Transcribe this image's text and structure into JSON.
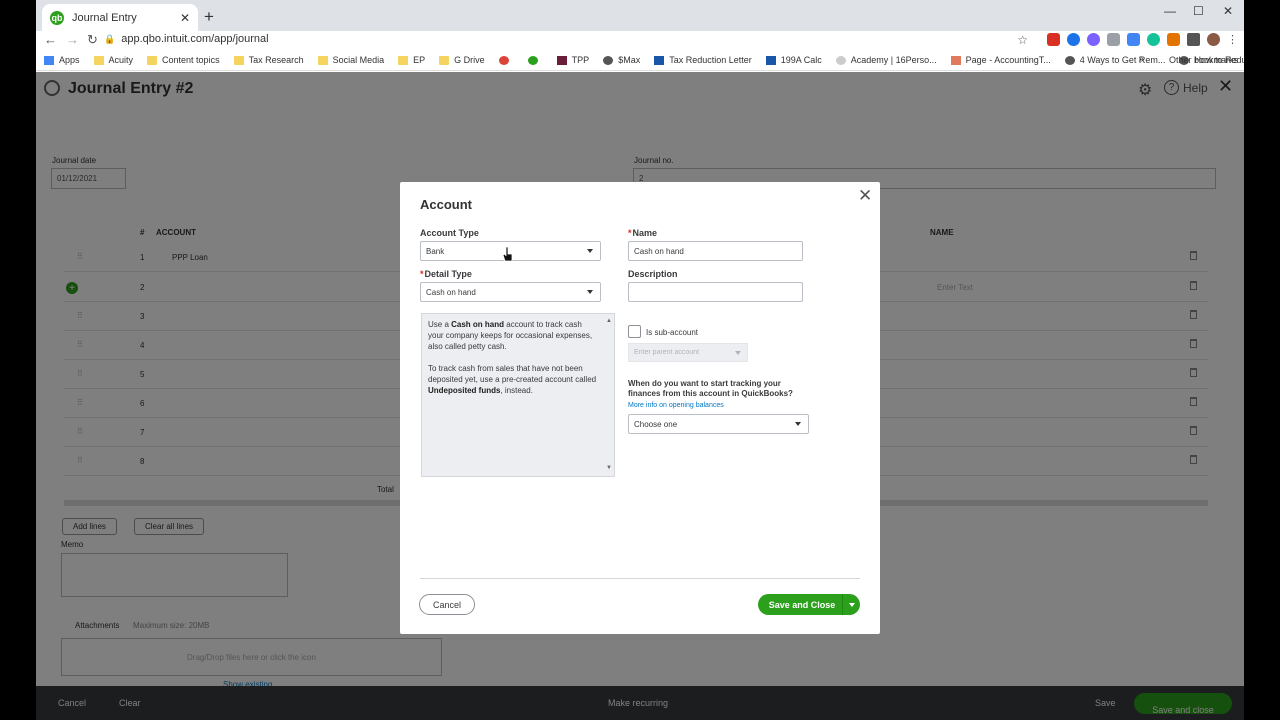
{
  "browser": {
    "tab_title": "Journal Entry",
    "url": "app.qbo.intuit.com/app/journal",
    "bookmarks": [
      "Apps",
      "Acuity",
      "Content topics",
      "Tax Research",
      "Social Media",
      "EP",
      "G Drive",
      "",
      "",
      "TPP",
      "$Max",
      "Tax Reduction Letter",
      "199A Calc",
      "Academy | 16Perso...",
      "Page - AccountingT...",
      "4 Ways to Get Rem...",
      "How to Reduce up t..."
    ],
    "bookmarks_more": "»",
    "other_bookmarks": "Other bookmarks"
  },
  "page": {
    "title": "Journal Entry #2",
    "help_label": "Help",
    "journal_date_label": "Journal date",
    "journal_date_value": "01/12/2021",
    "journal_no_label": "Journal no.",
    "journal_no_value": "2",
    "col_num": "#",
    "col_account": "ACCOUNT",
    "col_name": "NAME",
    "rows": [
      {
        "num": "1",
        "account": "PPP Loan"
      },
      {
        "num": "2",
        "account": ""
      },
      {
        "num": "3",
        "account": ""
      },
      {
        "num": "4",
        "account": ""
      },
      {
        "num": "5",
        "account": ""
      },
      {
        "num": "6",
        "account": ""
      },
      {
        "num": "7",
        "account": ""
      },
      {
        "num": "8",
        "account": ""
      }
    ],
    "name_placeholder": "Enter Text",
    "total_label": "Total",
    "add_lines": "Add lines",
    "clear_all_lines": "Clear all lines",
    "memo_label": "Memo",
    "attachments_label": "Attachments",
    "max_size": "Maximum size: 20MB",
    "drag_drop": "Drag/Drop files here or click the icon",
    "show_existing": "Show existing"
  },
  "footer": {
    "cancel": "Cancel",
    "clear": "Clear",
    "make_recurring": "Make recurring",
    "save": "Save",
    "save_and_close": "Save and close"
  },
  "modal": {
    "title": "Account",
    "account_type_label": "Account Type",
    "account_type_value": "Bank",
    "name_label": "Name",
    "name_value": "Cash on hand",
    "detail_type_label": "Detail Type",
    "detail_type_value": "Cash on hand",
    "description_label": "Description",
    "description_value": "",
    "info_p1_a": "Use a ",
    "info_p1_b": "Cash on hand",
    "info_p1_c": " account to track cash your company keeps for occasional expenses, also called petty cash.",
    "info_p2_a": "To track cash from sales that have not been deposited yet, use a pre-created account called ",
    "info_p2_b": "Undeposited funds",
    "info_p2_c": ", instead.",
    "sub_account_label": "Is sub-account",
    "parent_placeholder": "Enter parent account",
    "tracking_question": "When do you want to start tracking your finances from this account in QuickBooks?",
    "more_info": "More info on opening balances",
    "choose_one": "Choose one",
    "cancel": "Cancel",
    "save_and_close": "Save and Close"
  },
  "colors": {
    "brand_green": "#2ca01c",
    "link_blue": "#0077c5",
    "required_red": "#d52b1e"
  }
}
